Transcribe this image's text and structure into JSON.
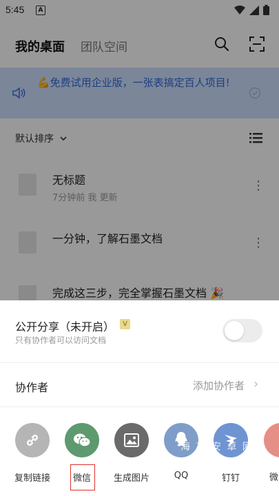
{
  "status_bar": {
    "time": "5:45",
    "notification_icon": "A"
  },
  "header": {
    "tab_active": "我的桌面",
    "tab_inactive": "团队空间"
  },
  "banner": {
    "text": "💪免费试用企业版，一张表搞定百人项目!"
  },
  "sort": {
    "label": "默认排序"
  },
  "documents": [
    {
      "title": "无标题",
      "meta": "7分钟前 我 更新"
    },
    {
      "title": "一分钟，了解石墨文档",
      "meta": ""
    },
    {
      "title": "完成这三步，完全掌握石墨文档 🎉",
      "meta": ""
    }
  ],
  "share_sheet": {
    "public_title": "公开分享（未开启）",
    "public_badge": "V",
    "public_subtitle": "只有协作者可以访问文档",
    "collaborators_label": "协作者",
    "add_collaborator": "添加协作者",
    "actions": [
      {
        "label": "复制链接",
        "icon": "link-icon",
        "color": "#b5b5b5"
      },
      {
        "label": "微信",
        "icon": "wechat-icon",
        "color": "#5d9a6f"
      },
      {
        "label": "生成图片",
        "icon": "image-icon",
        "color": "#6a6a6a"
      },
      {
        "label": "QQ",
        "icon": "qq-icon",
        "color": "#7f9dc9"
      },
      {
        "label": "钉钉",
        "icon": "dingtalk-icon",
        "color": "#6f94d2"
      },
      {
        "label": "微",
        "icon": "weibo-icon",
        "color": "#e58f86"
      }
    ]
  },
  "watermark": "海 花 安 卓 网"
}
